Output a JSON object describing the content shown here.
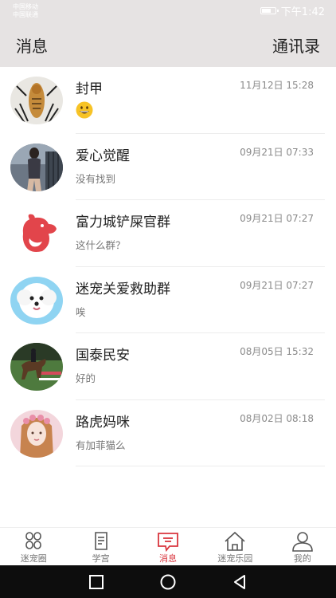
{
  "status_bar": {
    "carrier_line1": "中国移动",
    "carrier_line2": "中国联通",
    "time": "下午1:42"
  },
  "header": {
    "title": "消息",
    "contacts_label": "通讯录"
  },
  "chats": [
    {
      "name": "封甲",
      "time": "11月12日 15:28",
      "preview": "",
      "preview_icon": "grinning-face-emoji-icon",
      "avatar_icon": "tiger-photo-avatar"
    },
    {
      "name": "爱心觉醒",
      "time": "09月21日 07:33",
      "preview": "没有找到",
      "avatar_icon": "woman-photo-avatar"
    },
    {
      "name": "富力城铲屎官群",
      "time": "09月21日 07:27",
      "preview": "这什么群？",
      "avatar_icon": "pet-logo-avatar"
    },
    {
      "name": "迷宠关爱救助群",
      "time": "09月21日 07:27",
      "preview": "唉",
      "avatar_icon": "white-dog-avatar"
    },
    {
      "name": "国泰民安",
      "time": "08月05日 15:32",
      "preview": "好的",
      "avatar_icon": "horse-rider-avatar"
    },
    {
      "name": "路虎妈咪",
      "time": "08月02日 08:18",
      "preview": "有加菲猫么",
      "avatar_icon": "flower-girl-avatar"
    }
  ],
  "tabs": [
    {
      "label": "迷宠圈",
      "icon": "clover-icon",
      "active": false
    },
    {
      "label": "学宫",
      "icon": "book-icon",
      "active": false
    },
    {
      "label": "消息",
      "icon": "message-icon",
      "active": true
    },
    {
      "label": "迷宠乐园",
      "icon": "home-icon",
      "active": false
    },
    {
      "label": "我的",
      "icon": "user-icon",
      "active": false
    }
  ],
  "colors": {
    "header_bg": "#e6e3e3",
    "active_tab": "#d9363e",
    "nav_bar": "#0d0d0d"
  }
}
